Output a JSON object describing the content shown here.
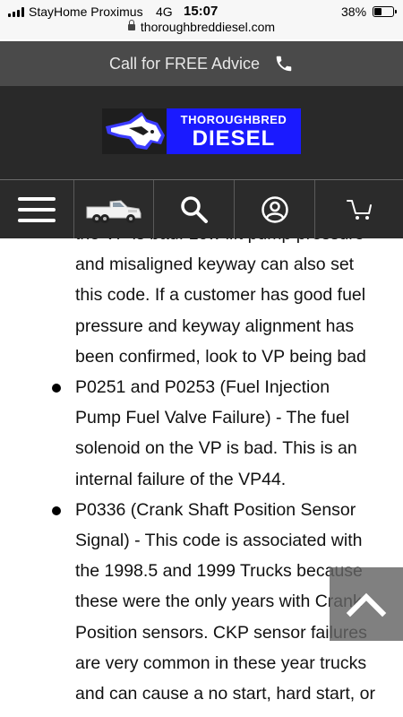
{
  "status_bar": {
    "carrier": "StayHome Proximus",
    "network": "4G",
    "time": "15:07",
    "battery_percent": "38%",
    "battery_level": 0.38,
    "url": "thoroughbreddiesel.com"
  },
  "advice_bar": {
    "text": "Call for FREE Advice",
    "icon": "phone-icon"
  },
  "logo": {
    "line1": "THOROUGHBRED",
    "line2": "DIESEL",
    "icon": "horse-head-logo",
    "brand_blue": "#1a1aff"
  },
  "nav": {
    "items": [
      {
        "name": "menu",
        "icon": "hamburger-menu-icon"
      },
      {
        "name": "vehicle",
        "icon": "pickup-truck-icon"
      },
      {
        "name": "search",
        "icon": "search-icon"
      },
      {
        "name": "account",
        "icon": "account-icon"
      },
      {
        "name": "cart",
        "icon": "cart-icon"
      }
    ]
  },
  "article": {
    "items": [
      {
        "bullet_visible": false,
        "lines": [
          "the VP is bad. Low lift pump pressure",
          "and misaligned keyway can also set",
          "this code. If a customer has good fuel",
          "pressure and keyway alignment has",
          "been confirmed, look to VP being bad"
        ]
      },
      {
        "bullet_visible": true,
        "lines": [
          "P0251 and P0253 (Fuel Injection",
          "Pump Fuel Valve Failure) - The fuel",
          "solenoid on the VP is bad. This is an",
          "internal failure of the VP44."
        ]
      },
      {
        "bullet_visible": true,
        "lines": [
          "P0336 (Crank Shaft Position Sensor",
          "Signal) - This code is associated with",
          "the 1998.5 and 1999 Trucks because",
          "these were the only years with Crank",
          "Position sensors. CKP sensor failures",
          "are very common in these year trucks",
          "and can cause a no start, hard start, or"
        ]
      }
    ]
  },
  "scroll_top": {
    "icon": "chevron-up-icon"
  }
}
